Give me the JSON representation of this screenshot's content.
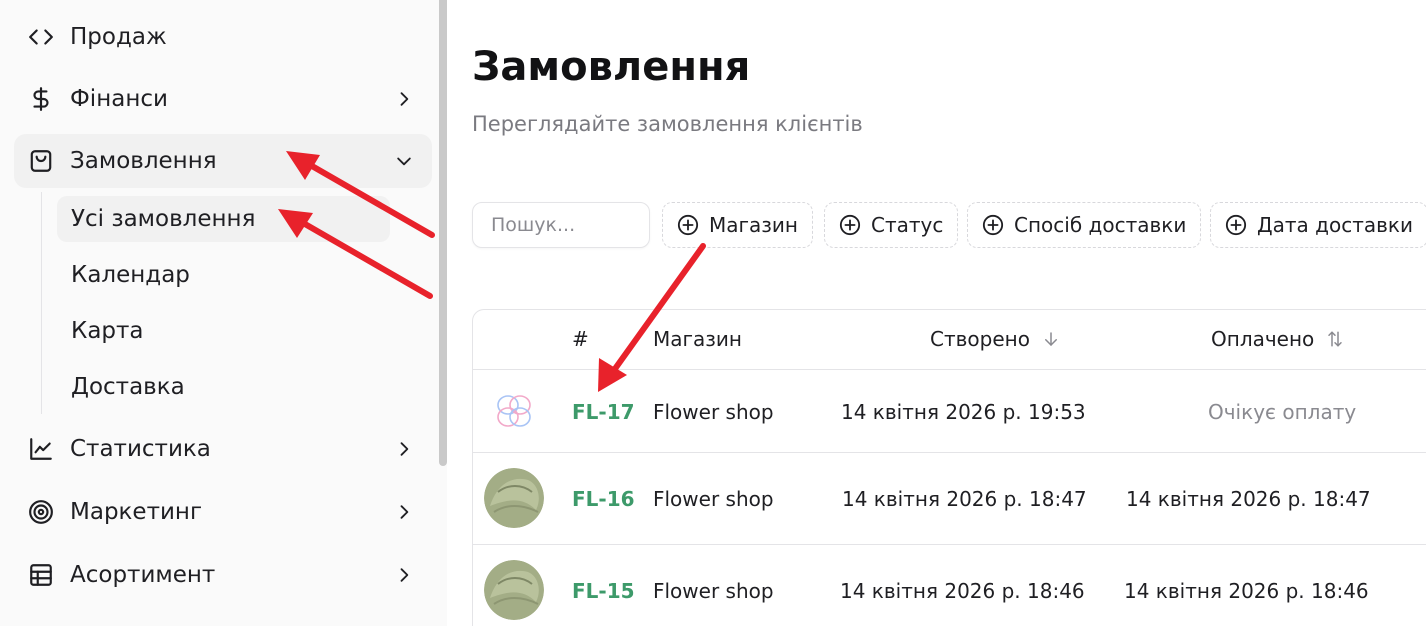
{
  "sidebar": {
    "items": [
      {
        "label": "Продаж",
        "icon": "code-icon"
      },
      {
        "label": "Фінанси",
        "icon": "dollar-icon"
      },
      {
        "label": "Замовлення",
        "icon": "shopping-bag-icon"
      },
      {
        "label": "Статистика",
        "icon": "line-chart-icon"
      },
      {
        "label": "Маркетинг",
        "icon": "target-icon"
      },
      {
        "label": "Асортимент",
        "icon": "grid-table-icon"
      }
    ],
    "sub_items": [
      {
        "label": "Усі замовлення"
      },
      {
        "label": "Календар"
      },
      {
        "label": "Карта"
      },
      {
        "label": "Доставка"
      }
    ]
  },
  "main": {
    "title": "Замовлення",
    "subtitle": "Переглядайте замовлення клієнтів",
    "search": {
      "placeholder": "Пошук..."
    },
    "filters": [
      {
        "label": "Магазин"
      },
      {
        "label": "Статус"
      },
      {
        "label": "Спосіб доставки"
      },
      {
        "label": "Дата доставки"
      }
    ],
    "table": {
      "headers": {
        "number": "#",
        "shop": "Магазин",
        "created": "Створено",
        "paid": "Оплачено"
      },
      "rows": [
        {
          "order": "FL-17",
          "shop": "Flower shop",
          "created": "14 квітня 2026 р. 19:53",
          "paid": "Очікує оплату",
          "thumb": "placeholder-logo"
        },
        {
          "order": "FL-16",
          "shop": "Flower shop",
          "created": "14 квітня 2026 р. 18:47",
          "paid": "14 квітня 2026 р. 18:47",
          "thumb": "product-photo"
        },
        {
          "order": "FL-15",
          "shop": "Flower shop",
          "created": "14 квітня 2026 р. 18:46",
          "paid": "14 квітня 2026 р. 18:46",
          "thumb": "product-photo"
        }
      ]
    }
  },
  "colors": {
    "order_link": "#3d9a6a",
    "annotation_arrow": "#e8222b",
    "sidebar_bg": "#fafafa",
    "active_item_bg": "#f1f1f1"
  }
}
